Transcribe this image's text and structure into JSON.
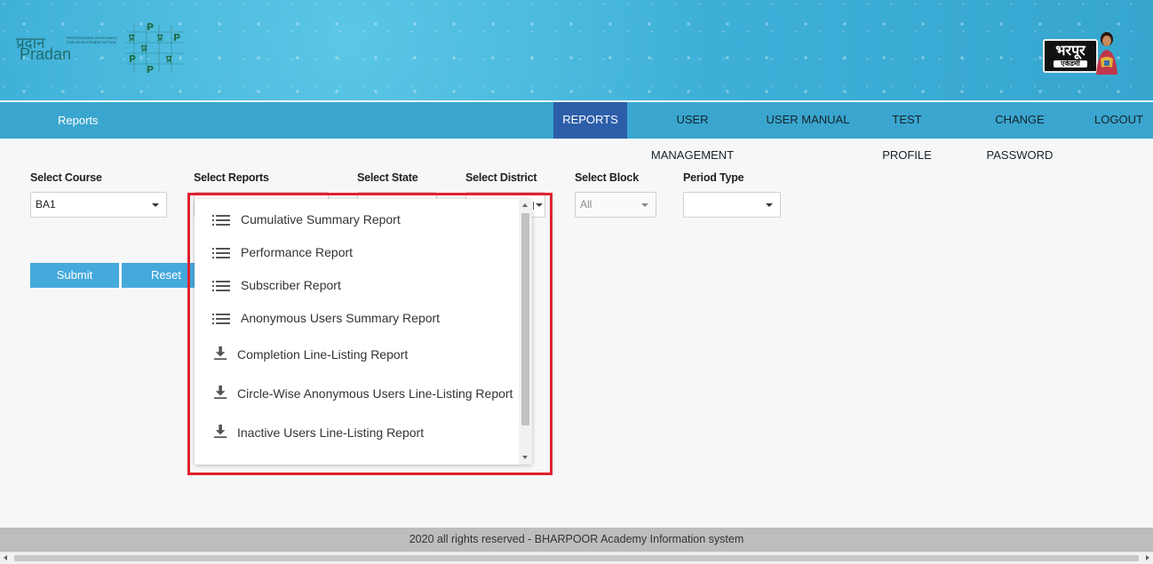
{
  "header": {
    "pradan_logo_hindi": "प्रदान",
    "pradan_logo_text": "Pradan",
    "pradan_logo_tagline": "PROFESSIONAL ASSISTANCE FOR DEVELOPMENT ACTION",
    "grid_logo_letters": [
      "प्र",
      "P",
      "प्र",
      "P",
      "प्र",
      "P",
      "प्र",
      "P"
    ],
    "bharpoor_logo_big": "भरपूर",
    "bharpoor_logo_small": "एकेडमी"
  },
  "nav": {
    "brand": "Reports",
    "items": [
      {
        "label": "REPORTS",
        "active": true
      },
      {
        "label": "USER MANAGEMENT",
        "active": false
      },
      {
        "label": "USER MANUAL",
        "active": false
      },
      {
        "label": "TEST PROFILE",
        "active": false
      },
      {
        "label": "CHANGE PASSWORD",
        "active": false
      },
      {
        "label": "LOGOUT",
        "active": false
      }
    ],
    "active_color": "#2d5ea9",
    "bar_color": "#3aa6cf"
  },
  "filters": {
    "course": {
      "label": "Select Course",
      "value": "BA1"
    },
    "reports": {
      "label": "Select Reports",
      "value": ""
    },
    "state": {
      "label": "Select State"
    },
    "district": {
      "label": "Select District"
    },
    "block": {
      "label": "Select Block",
      "value": "All"
    },
    "period": {
      "label": "Period Type",
      "value": ""
    }
  },
  "buttons": {
    "submit": "Submit",
    "reset": "Reset",
    "color": "#45a9dc"
  },
  "reports_dropdown": {
    "items": [
      {
        "label": "Cumulative Summary Report",
        "icon": "list-icon"
      },
      {
        "label": "Performance Report",
        "icon": "list-icon"
      },
      {
        "label": "Subscriber Report",
        "icon": "list-icon"
      },
      {
        "label": "Anonymous Users Summary Report",
        "icon": "list-icon"
      },
      {
        "label": "Completion Line-Listing Report",
        "icon": "download-icon"
      },
      {
        "label": "Circle-Wise Anonymous Users Line-Listing Report",
        "icon": "download-icon"
      },
      {
        "label": "Inactive Users Line-Listing Report",
        "icon": "download-icon"
      }
    ],
    "highlight_color": "#e0212e"
  },
  "footer": {
    "text": "2020 all rights reserved - BHARPOOR Academy Information system"
  }
}
